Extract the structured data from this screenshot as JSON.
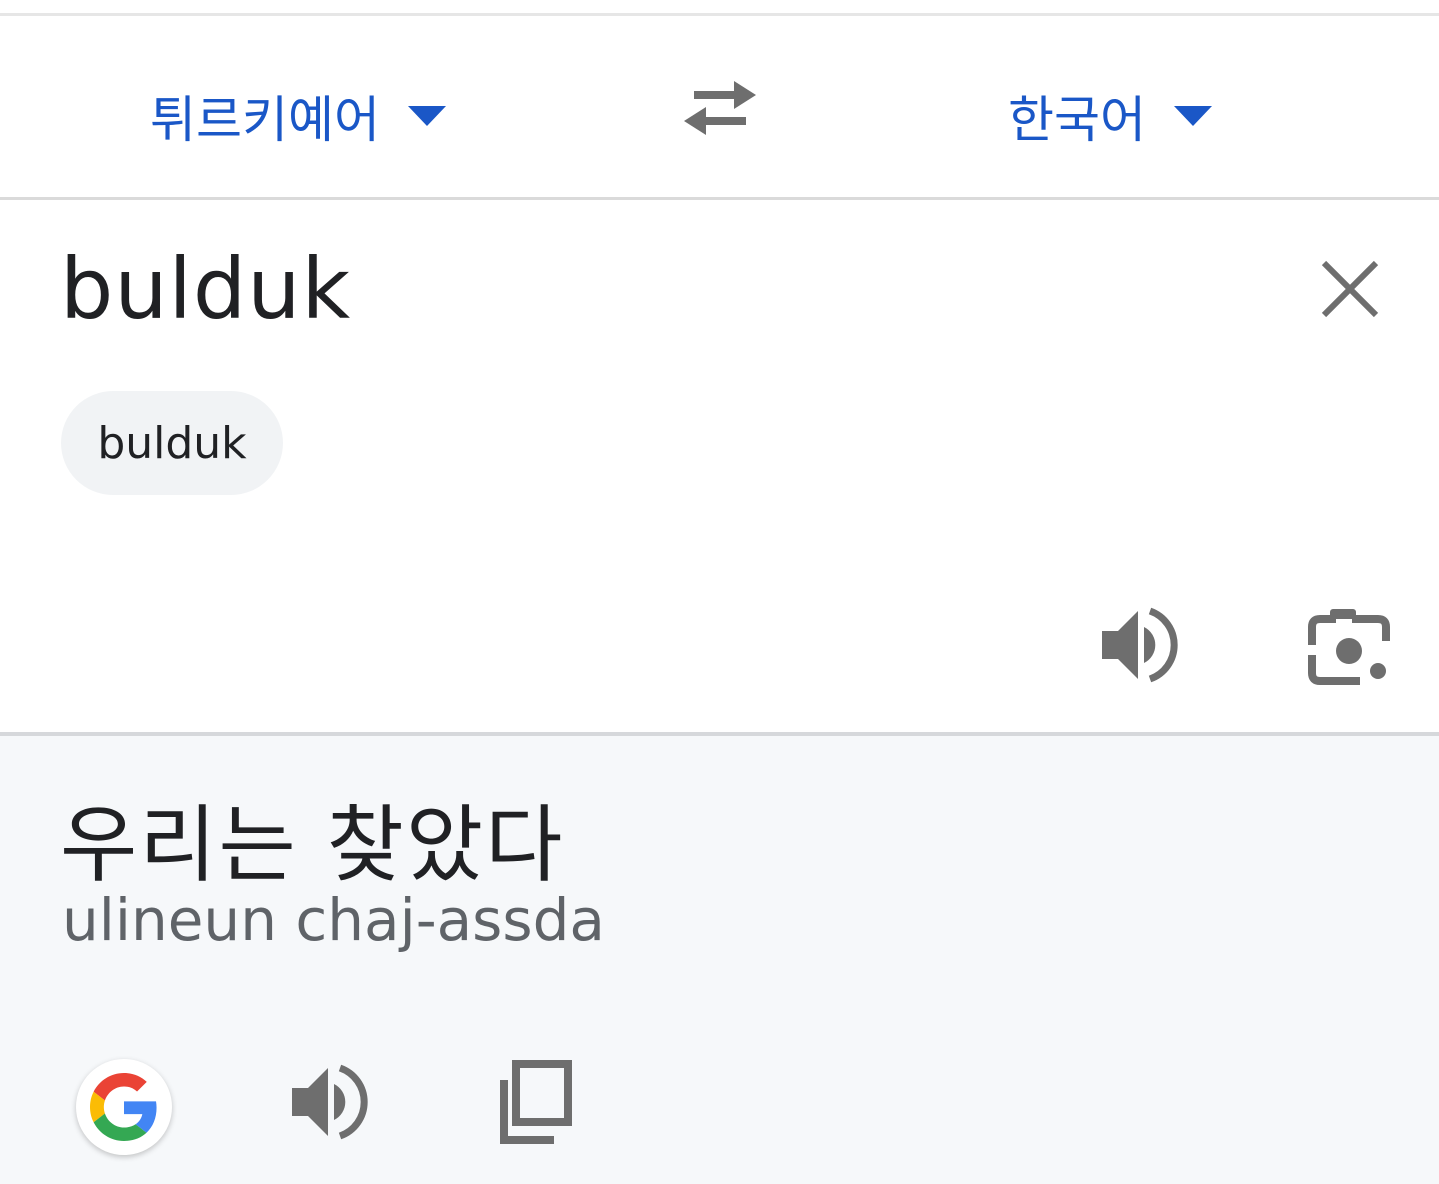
{
  "language_bar": {
    "source_language": "튀르키예어",
    "target_language": "한국어",
    "swap_icon": "swap-arrows-icon"
  },
  "input": {
    "text": "bulduk",
    "suggestion_chip": "bulduk",
    "icons": [
      "close-icon",
      "speaker-icon",
      "camera-lens-icon"
    ]
  },
  "output": {
    "translation": "우리는 찾았다",
    "transliteration": "ulineun chaj-assda",
    "icons": [
      "google-g-icon",
      "speaker-icon",
      "copy-icon"
    ]
  },
  "colors": {
    "accent": "#1a57c7",
    "icon_gray": "#6e6e6e",
    "output_bg": "#f6f8fa",
    "chip_bg": "#f1f3f5"
  }
}
